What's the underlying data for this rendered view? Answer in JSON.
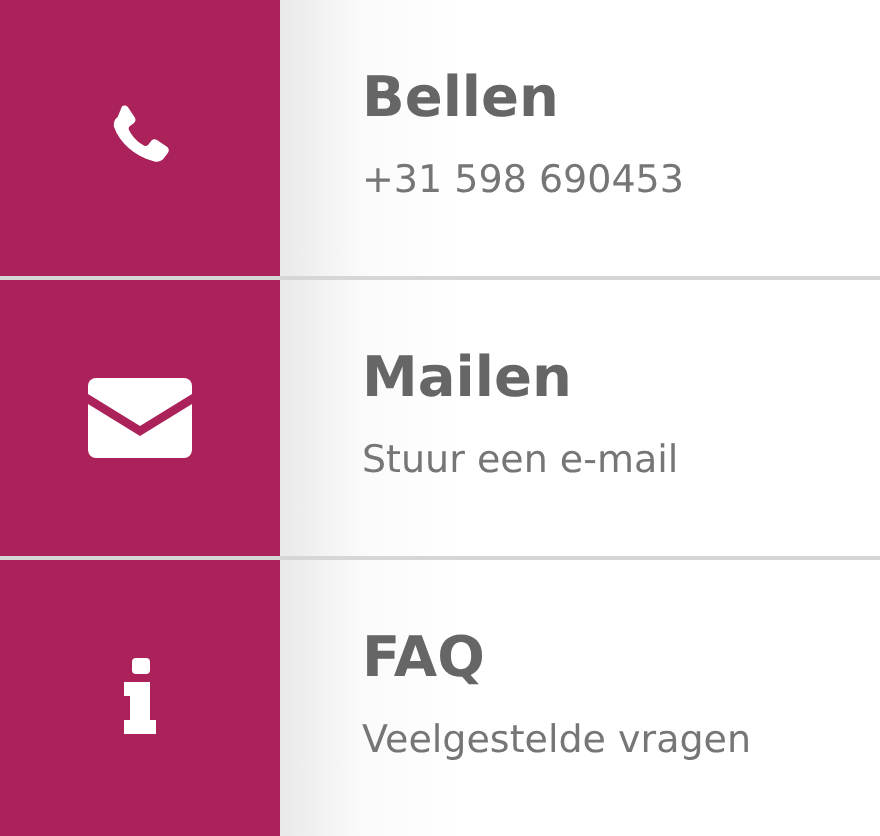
{
  "contacts": [
    {
      "kind": "phone",
      "title": "Bellen",
      "subtitle": "+31 598 690453"
    },
    {
      "kind": "mail",
      "title": "Mailen",
      "subtitle": "Stuur een e-mail"
    },
    {
      "kind": "info",
      "title": "FAQ",
      "subtitle": "Veelgestelde vragen"
    }
  ]
}
